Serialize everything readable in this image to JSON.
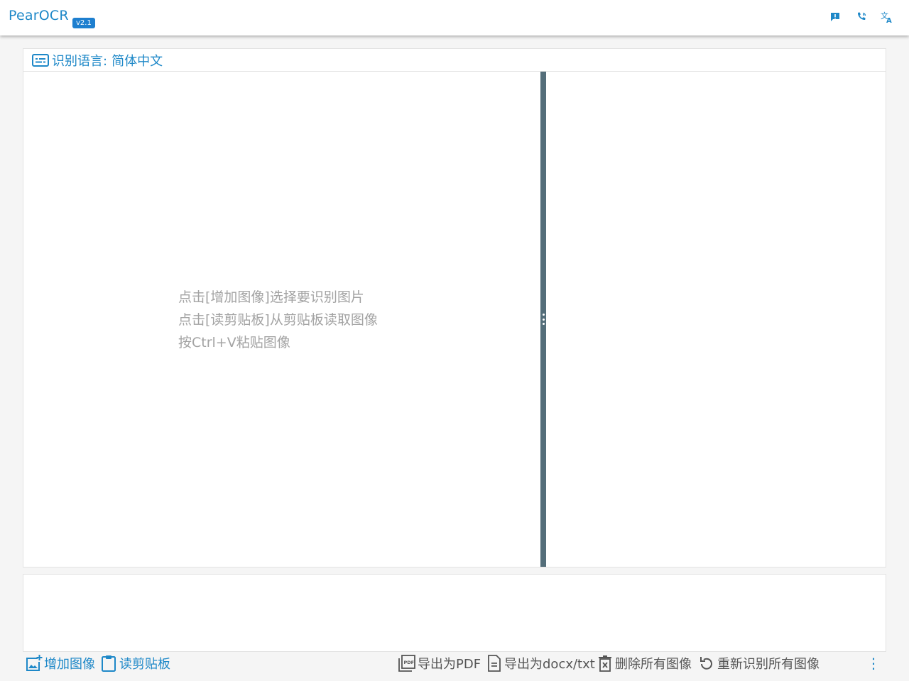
{
  "app": {
    "title": "PearOCR",
    "version": "v2.1"
  },
  "header_icons": [
    {
      "name": "feedback-icon",
      "color": "#1e88c8"
    },
    {
      "name": "contact-icon",
      "color": "#1e88c8"
    },
    {
      "name": "translate-icon",
      "color": "#1e88c8"
    }
  ],
  "language": {
    "label": "识别语言:",
    "value": "简体中文"
  },
  "hints": [
    "点击[增加图像]选择要识别图片",
    "点击[读剪贴板]从剪贴板读取图像",
    "按Ctrl+V粘贴图像"
  ],
  "actions_left": {
    "add_image": "增加图像",
    "read_clipboard": "读剪贴板"
  },
  "actions_right": {
    "export_pdf": "导出为PDF",
    "export_docx": "导出为docx/txt",
    "delete_all": "删除所有图像",
    "re_recognize": "重新识别所有图像",
    "more": "⋮"
  },
  "colors": {
    "accent": "#1e88c8",
    "divider": "#546e7a",
    "hint_text": "#a3a3a3"
  }
}
